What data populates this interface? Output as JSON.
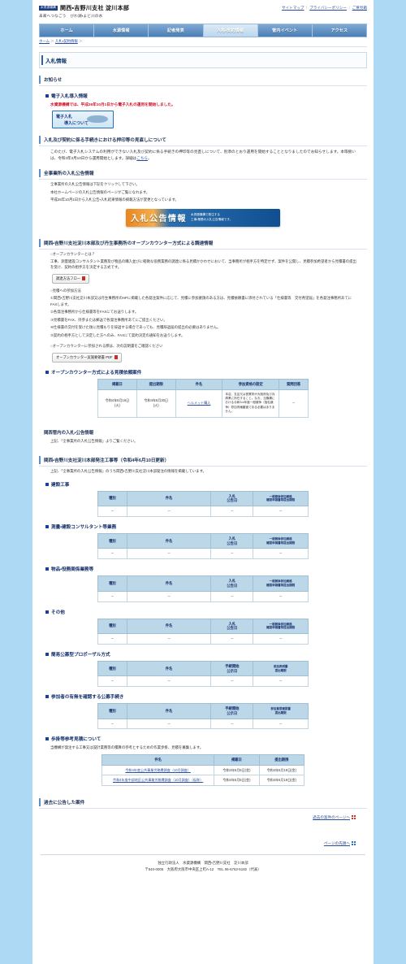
{
  "header": {
    "logo_mark": "水資源機構",
    "org_name": "関西・吉野川支社 淀川本部",
    "tagline": "未来へつなごう　びわ湖・よど川の水",
    "links": [
      {
        "label": "サイトマップ",
        "name": "sitemap-link"
      },
      {
        "label": "プライバシーポリシー",
        "name": "privacy-policy-link"
      },
      {
        "label": "ご意見箱",
        "name": "feedback-link"
      }
    ]
  },
  "nav": {
    "items": [
      {
        "label": "ホーム",
        "active": false
      },
      {
        "label": "水源情報",
        "active": false
      },
      {
        "label": "記者発表",
        "active": false
      },
      {
        "label": "入札・契約情報",
        "active": true
      },
      {
        "label": "管内イベント",
        "active": false
      },
      {
        "label": "アクセス",
        "active": false
      }
    ]
  },
  "breadcrumb": {
    "home": "ホーム",
    "current": "入札・契約情報",
    "sep": "＞"
  },
  "page_title": "入札情報",
  "sections": {
    "oshirase": {
      "title": "お知らせ",
      "ebid": {
        "heading": "電子入札導入情報",
        "red_text": "水資源機構では、平成26年10月1日から電子入札の運用を開始しました。",
        "banner_line1": "電子入札",
        "banner_line2": "導入について"
      },
      "ouin": {
        "heading": "入札及び契約に係る手続きにおける押印等の見直しについて",
        "body": "このたび、電子入札システムの利用ができない入札及び契約に係る手続きの押印等の見直しについて、別添のとおり運用を開始することとなりましたのでお知らせします。本取扱いは、令和3年3月10日から運用開始とします。詳細は",
        "link": "こちら",
        "tail": "。"
      },
      "zenjigyosho": {
        "heading": "全事業所の入札公告情報",
        "line1": "全事業所の入札公告情報は下記をクリックして下さい。",
        "line2": "本社ホームページの入札公告情報のページがご覧になれます。",
        "line3": "平成26年10月1日から入札公告・入札結果情報の掲載方法が変更となっています。",
        "banner_big": "入札公告情報",
        "banner_small_1": "水資源機構で発注する",
        "banner_small_2": "工事・業務の入札公告情報です。"
      }
    },
    "open_counter": {
      "heading": "関西・吉野川支社淀川本部及び丹生事務所のオープンカウンター方式による調達情報",
      "what_is_title": "○オープンカウンターとは？",
      "what_is_body": "工事、測量建設コンサルタント業務及び物品の購入並びに軽微な役務業務の調達に係る見積かかわせにおいて、当事務所が相手方を特定せず、案件を公開し、見積参加希望者から見積書の提出を受け、契約の相手方を決定する方式です。",
      "flow_button": "調達方法フロー",
      "join_title": "○見積への参加方法",
      "join_items": [
        "①関西・吉野川支社淀川本部又は丹生事務所のHPに掲載した各発注案件に応じて、見積に参加要請のある方は、見積依頼書に添付されている「仕様書等　交付希望届」を各発注事務所あてにFAXします。",
        "②各発注事務所から仕様書等をFAXにてお送りします。",
        "③見積書をFAX、持参または郵送で各発注事務所あてにご提出ください。",
        "④仕様書の交付を受けた後に見積もりを辞退する場合であっても、見積辞退届の提出の必要はありません。",
        "⑤契約の相手方として決定した方へのみ、FAXにて契約決定の通知をお送りします。"
      ],
      "manual_note": "○オープンカウンターに参加される際は、次の説明書をご確認ください",
      "manual_button": "オープンカウンター実施要領書 PDF",
      "table_title": "オープンカウンター方式による見積依頼案件",
      "table": {
        "columns": [
          "掲載日",
          "提出期限",
          "件名",
          "参加資格の設定",
          "質問回答"
        ],
        "rows": [
          {
            "keisaibi": "令和4年6月16日\n(火)",
            "teishutsu": "令和4年6月30日\n(火)",
            "kenmei": "ヘルメット購入",
            "shikaku": "本店、支店又は営業所が大阪府及び兵庫県に所在すること。なお、当機構における令和3・4年度一般競争（指名競争）参加資格審査である必要はありません。",
            "shitsumon": "－"
          }
        ]
      }
    },
    "kansai_kannai": {
      "heading": "関西管内の入札・公告情報",
      "body": "上記、「全事業所の入札公告情報」よりご覧ください。"
    },
    "yodogawa": {
      "heading": "関西・吉野川支社淀川本部発注工事等（令和4年6月10日更新）",
      "body": "上記、「全事業所の入札公告情報」のうち関西・吉野川支社淀川本部発注の情報を掲載しています。",
      "std_columns": [
        "種別",
        "件名",
        "入札\n公告日",
        "一般競争参加資格\n確認申請書等提出期限"
      ],
      "proposal_columns": [
        "種別",
        "件名",
        "手続開始\n公示日",
        "参加表明書\n提出期限"
      ],
      "koubo_columns": [
        "種別",
        "件名",
        "手続開始\n公示日",
        "参加意思確認書\n提出期限"
      ],
      "groups": [
        {
          "heading": "建設工事",
          "columns_key": "std",
          "rows": [
            [
              "－",
              "－",
              "－",
              "－"
            ]
          ]
        },
        {
          "heading": "測量・建設コンサルタント等業務",
          "columns_key": "std",
          "rows": [
            [
              "－",
              "－",
              "－",
              "－"
            ]
          ]
        },
        {
          "heading": "物品・役務関係業務等",
          "columns_key": "std",
          "rows": [
            [
              "－",
              "－",
              "－",
              "－"
            ]
          ]
        },
        {
          "heading": "その他",
          "columns_key": "std",
          "rows": [
            [
              "－",
              "－",
              "－",
              "－"
            ]
          ]
        },
        {
          "heading": "簡易公募型プロポーザル方式",
          "columns_key": "proposal",
          "rows": [
            [
              "－",
              "－",
              "－",
              "－"
            ]
          ]
        },
        {
          "heading": "参加者の有無を確認する公募手続き",
          "columns_key": "koubo",
          "rows": [
            [
              "－",
              "－",
              "－",
              "－"
            ]
          ]
        }
      ]
    },
    "bugakari": {
      "heading": "歩掛等参考見積について",
      "body": "当機構が発注する工事又は設計業務等の積算の参考とするための作業歩掛、見積を募集します。",
      "table": {
        "columns": [
          "件名",
          "掲載日",
          "提出期限"
        ],
        "rows": [
          {
            "kenmei": "令和4年度公共事業労務費調査（10月調査）",
            "keisaibi": "令和4年6月5日(金)",
            "teishutsu": "令和4年6月19日(金)"
          },
          {
            "kenmei": "令和4年度中部地区公共事業労務費調査（10月調査）（仮称）",
            "keisaibi": "令和4年6月5日(金)",
            "teishutsu": "令和4年6月19日(金)"
          }
        ]
      }
    },
    "past": {
      "heading": "過去に公告した案件",
      "link": "過去の案件のページへ"
    }
  },
  "page_top_link": "ページの先頭へ",
  "footer": {
    "line1": "独立行政法人　水資源機構　関西・吉野川支社　淀川本部",
    "line2": "〒540-0005　大阪府大阪市中央区上町A-12　TEL 06-6763-5182（代表）"
  },
  "colors": {
    "nav_blue": "#4a7fb5",
    "heading_navy": "#143a72",
    "accent_red": "#d5122a",
    "link_blue": "#2b4fa0",
    "table_header": "#bcd7e8"
  }
}
